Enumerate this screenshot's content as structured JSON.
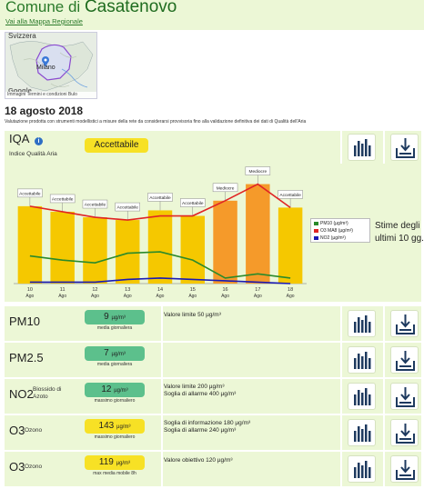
{
  "header": {
    "title_prefix": "Comune di ",
    "title_name": "Casatenovo",
    "back_link": "Vai alla Mappa Regionale"
  },
  "map": {
    "country_label": "Svizzera",
    "city_label": "Milano",
    "google_label": "Google",
    "footer": "Immagini  Termini e condizioni  Bulo"
  },
  "date": "18 agosto 2018",
  "disclaimer": "Valutazione prodotta con strumenti modellistici a misure della rete da considerarsi provvisoria fino alla validazione definitiva dei dati di Qualità dell'Aria",
  "iqa": {
    "label": "IQA",
    "sublabel": "Indice Qualità Aria",
    "badge": "Accettabile",
    "badge_color": "#f7e125",
    "info_icon": "info-icon"
  },
  "chart_data": {
    "type": "bar",
    "categories": [
      "10\nAgo",
      "11\nAgo",
      "12\nAgo",
      "13\nAgo",
      "14\nAgo",
      "15\nAgo",
      "16\nAgo",
      "17\nAgo",
      "18\nAgo"
    ],
    "category_days": [
      "10",
      "11",
      "12",
      "13",
      "14",
      "15",
      "16",
      "17",
      "18"
    ],
    "category_month": "Ago",
    "bar_labels": [
      "Accettabile",
      "Accettabile",
      "Accettabile",
      "Accettabile",
      "Accettabile",
      "Accettabile",
      "Mediocre",
      "Mediocre",
      "Accettabile"
    ],
    "bar_values": [
      112,
      104,
      96,
      92,
      106,
      98,
      120,
      144,
      110
    ],
    "bar_colors": [
      "#f5c800",
      "#f5c800",
      "#f5c800",
      "#f5c800",
      "#f5c800",
      "#f5c800",
      "#f59a2a",
      "#f59a2a",
      "#f5c800"
    ],
    "ylim": [
      0,
      150
    ],
    "series": [
      {
        "name": "PM10 (µg/m³)",
        "color": "#2a8a2a",
        "values": [
          40,
          34,
          30,
          44,
          46,
          34,
          8,
          14,
          8
        ]
      },
      {
        "name": "O3 MA8 (µg/m³)",
        "color": "#e02424",
        "values": [
          112,
          104,
          96,
          92,
          98,
          98,
          120,
          144,
          110
        ]
      },
      {
        "name": "NO2 (µg/m³)",
        "color": "#1a1ab4",
        "values": [
          2,
          2,
          2,
          6,
          8,
          6,
          4,
          2,
          0
        ]
      }
    ],
    "side_note_line1": "Stime degli",
    "side_note_line2": "ultimi 10 gg."
  },
  "rows": [
    {
      "name": "PM10",
      "desc": "",
      "value": "9",
      "unit": "µg/m³",
      "sub": "media giornaliera",
      "color": "#5cc08c",
      "text1": "Valore limite 50 µg/m³",
      "text2": ""
    },
    {
      "name": "PM2.5",
      "desc": "",
      "value": "7",
      "unit": "µg/m³",
      "sub": "media giornaliera",
      "color": "#5cc08c",
      "text1": "",
      "text2": ""
    },
    {
      "name": "NO2",
      "desc": "Biossido di Azoto",
      "value": "12",
      "unit": "µg/m³",
      "sub": "massimo giornaliero",
      "color": "#5cc08c",
      "text1": "Valore limite 200 µg/m³",
      "text2": "Soglia di allarme 400 µg/m³"
    },
    {
      "name": "O3",
      "desc": "Ozono",
      "value": "143",
      "unit": "µg/m³",
      "sub": "massimo giornaliero",
      "color": "#f7e125",
      "text1": "Soglia di informazione 180 µg/m³",
      "text2": "Soglia di allarme 240 µg/m³"
    },
    {
      "name": "O3",
      "desc": "Ozono",
      "value": "119",
      "unit": "µg/m³",
      "sub": "max media mobile 8h",
      "color": "#f7e125",
      "text1": "Valore obiettivo 120 µg/m³",
      "text2": ""
    }
  ],
  "icons": {
    "chart": "bar-chart-icon",
    "download": "download-tray-icon"
  }
}
